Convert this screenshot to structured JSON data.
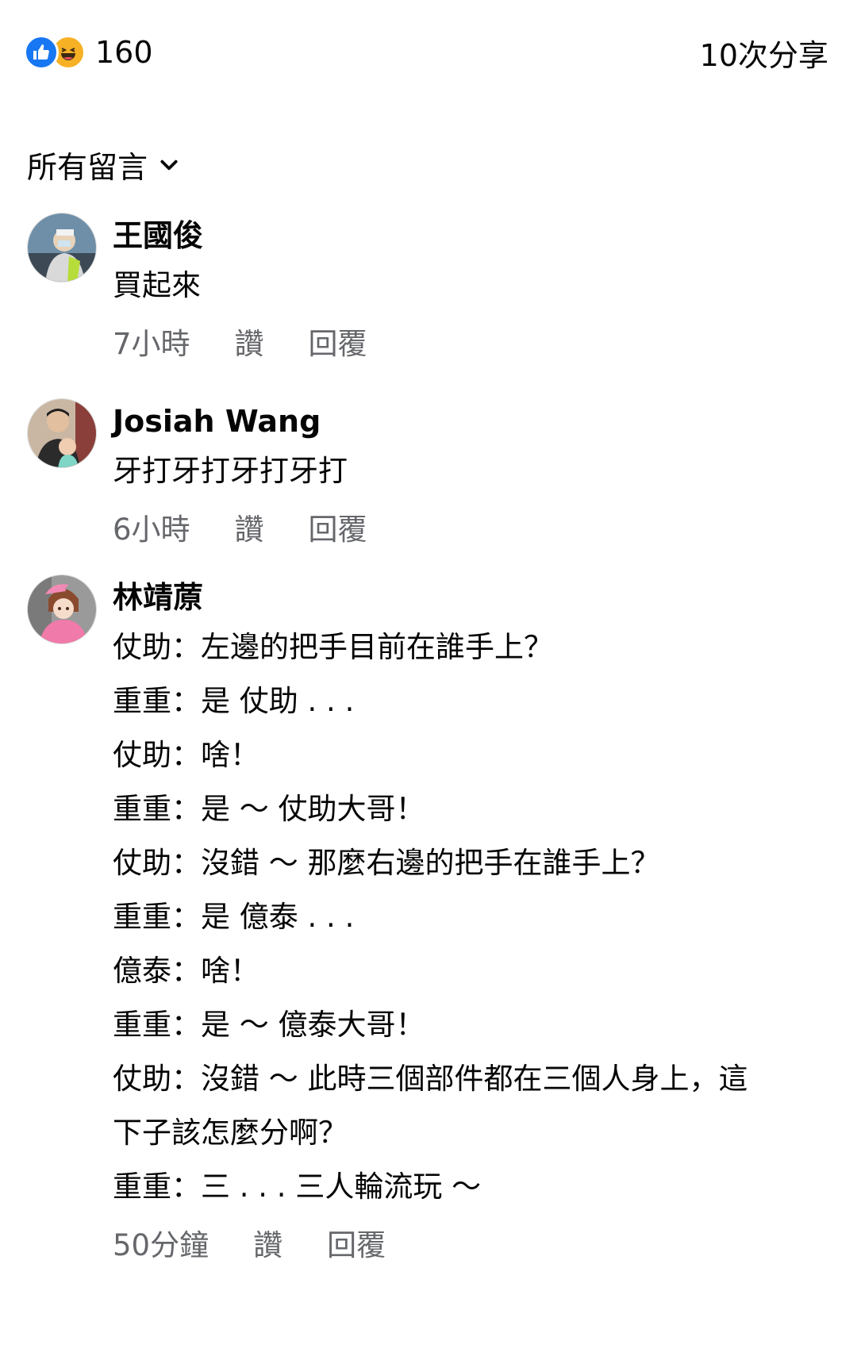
{
  "reactions": {
    "count": "160",
    "shares": "10次分享"
  },
  "filter": {
    "label": "所有留言"
  },
  "comments": [
    {
      "author": "王國俊",
      "lines": [
        "買起來"
      ],
      "time": "7小時",
      "like": "讚",
      "reply": "回覆"
    },
    {
      "author": "Josiah Wang",
      "lines": [
        "牙打牙打牙打牙打"
      ],
      "time": "6小時",
      "like": "讚",
      "reply": "回覆"
    },
    {
      "author": "林靖蒝",
      "lines": [
        "仗助：左邊的把手目前在誰手上？",
        "重重：是 仗助 . . .",
        "仗助：啥！",
        "重重：是 ～ 仗助大哥！",
        "仗助：沒錯 ～ 那麼右邊的把手在誰手上？",
        "重重：是 億泰 . . .",
        "億泰：啥！",
        "重重：是 ～ 億泰大哥！",
        "仗助：沒錯 ～ 此時三個部件都在三個人身上，這",
        "下子該怎麼分啊？",
        "重重：三 . . . 三人輪流玩 ～"
      ],
      "time": "50分鐘",
      "like": "讚",
      "reply": "回覆"
    }
  ]
}
